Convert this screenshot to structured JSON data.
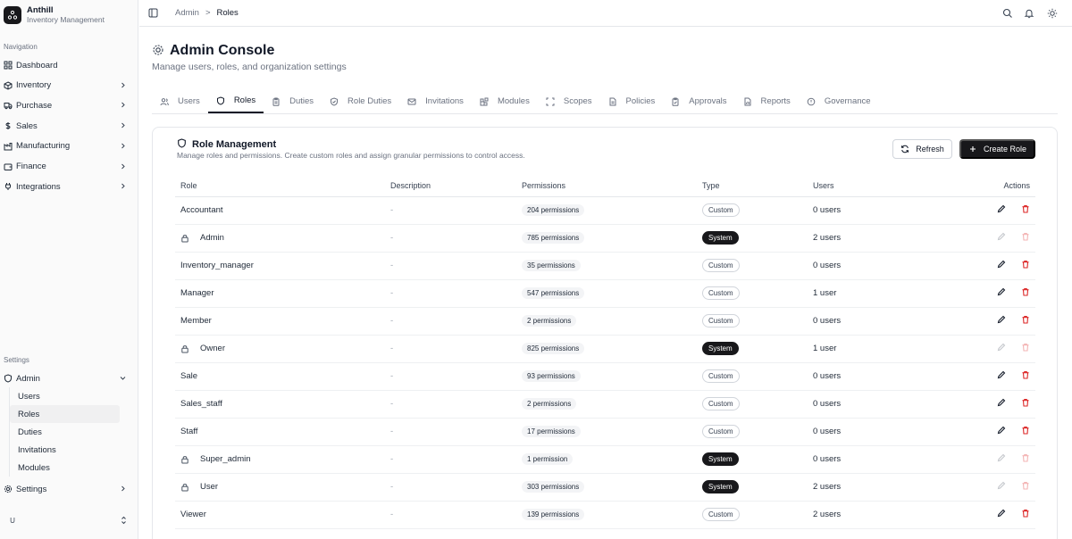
{
  "app": {
    "name": "Anthill",
    "subtitle": "Inventory Management"
  },
  "sidebar": {
    "nav_label": "Navigation",
    "nav": [
      {
        "label": "Dashboard",
        "icon": "dashboard-icon",
        "chevron": false
      },
      {
        "label": "Inventory",
        "icon": "package-icon",
        "chevron": true
      },
      {
        "label": "Purchase",
        "icon": "truck-icon",
        "chevron": true
      },
      {
        "label": "Sales",
        "icon": "dollar-icon",
        "chevron": true
      },
      {
        "label": "Manufacturing",
        "icon": "factory-icon",
        "chevron": true
      },
      {
        "label": "Finance",
        "icon": "wallet-icon",
        "chevron": true
      },
      {
        "label": "Integrations",
        "icon": "plug-icon",
        "chevron": true
      }
    ],
    "settings_label": "Settings",
    "admin": {
      "label": "Admin",
      "icon": "shield-icon",
      "expanded": true
    },
    "admin_items": [
      "Users",
      "Roles",
      "Duties",
      "Invitations",
      "Modules"
    ],
    "active_admin_item": "Roles",
    "settings_item": {
      "label": "Settings",
      "icon": "gear-icon"
    },
    "user": {
      "initial": "U"
    }
  },
  "topbar": {
    "breadcrumb": [
      "Admin",
      "Roles"
    ],
    "separator": ">"
  },
  "page": {
    "title": "Admin Console",
    "subtitle": "Manage users, roles, and organization settings"
  },
  "tabs": [
    {
      "label": "Users",
      "icon": "users-icon"
    },
    {
      "label": "Roles",
      "icon": "shield-icon",
      "active": true
    },
    {
      "label": "Duties",
      "icon": "clipboard-icon"
    },
    {
      "label": "Role Duties",
      "icon": "shield-check-icon"
    },
    {
      "label": "Invitations",
      "icon": "mail-icon"
    },
    {
      "label": "Modules",
      "icon": "blocks-icon"
    },
    {
      "label": "Scopes",
      "icon": "scan-icon"
    },
    {
      "label": "Policies",
      "icon": "file-icon"
    },
    {
      "label": "Approvals",
      "icon": "clipboard-check-icon"
    },
    {
      "label": "Reports",
      "icon": "report-icon"
    },
    {
      "label": "Governance",
      "icon": "badge-icon"
    }
  ],
  "card": {
    "title": "Role Management",
    "description": "Manage roles and permissions. Create custom roles and assign granular permissions to control access.",
    "refresh_label": "Refresh",
    "create_label": "Create Role"
  },
  "table": {
    "headers": {
      "role": "Role",
      "description": "Description",
      "permissions": "Permissions",
      "type": "Type",
      "users": "Users",
      "actions": "Actions"
    },
    "rows": [
      {
        "role": "Accountant",
        "description": "-",
        "permissions": "204 permissions",
        "type": "Custom",
        "users": "0 users",
        "locked": false
      },
      {
        "role": "Admin",
        "description": "-",
        "permissions": "785 permissions",
        "type": "System",
        "users": "2 users",
        "locked": true
      },
      {
        "role": "Inventory_manager",
        "description": "-",
        "permissions": "35 permissions",
        "type": "Custom",
        "users": "0 users",
        "locked": false
      },
      {
        "role": "Manager",
        "description": "-",
        "permissions": "547 permissions",
        "type": "Custom",
        "users": "1 user",
        "locked": false
      },
      {
        "role": "Member",
        "description": "-",
        "permissions": "2 permissions",
        "type": "Custom",
        "users": "0 users",
        "locked": false
      },
      {
        "role": "Owner",
        "description": "-",
        "permissions": "825 permissions",
        "type": "System",
        "users": "1 user",
        "locked": true
      },
      {
        "role": "Sale",
        "description": "-",
        "permissions": "93 permissions",
        "type": "Custom",
        "users": "0 users",
        "locked": false
      },
      {
        "role": "Sales_staff",
        "description": "-",
        "permissions": "2 permissions",
        "type": "Custom",
        "users": "0 users",
        "locked": false
      },
      {
        "role": "Staff",
        "description": "-",
        "permissions": "17 permissions",
        "type": "Custom",
        "users": "0 users",
        "locked": false
      },
      {
        "role": "Super_admin",
        "description": "-",
        "permissions": "1 permission",
        "type": "System",
        "users": "0 users",
        "locked": true
      },
      {
        "role": "User",
        "description": "-",
        "permissions": "303 permissions",
        "type": "System",
        "users": "2 users",
        "locked": true
      },
      {
        "role": "Viewer",
        "description": "-",
        "permissions": "139 permissions",
        "type": "Custom",
        "users": "2 users",
        "locked": false
      }
    ]
  },
  "colors": {
    "accent": "#18181b",
    "danger": "#dc2626",
    "muted": "#6b7280",
    "border": "#e5e7eb"
  }
}
